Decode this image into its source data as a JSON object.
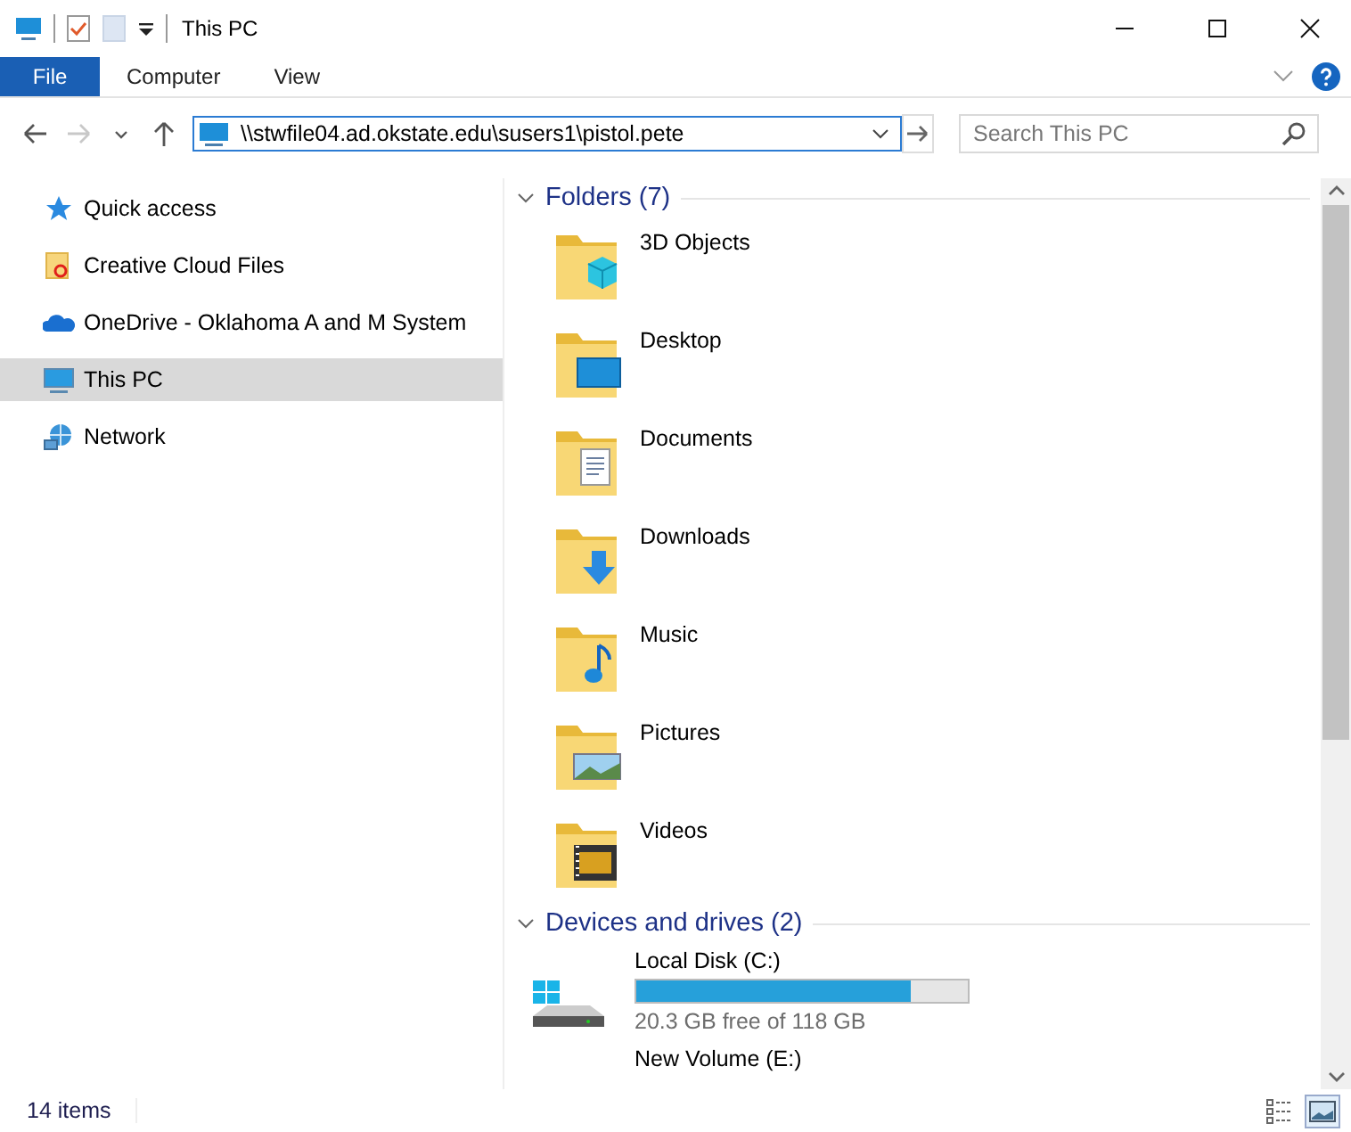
{
  "window": {
    "title": "This PC"
  },
  "ribbon": {
    "tabs": [
      {
        "label": "File",
        "kind": "file"
      },
      {
        "label": "Computer",
        "kind": "tab"
      },
      {
        "label": "View",
        "kind": "tab"
      }
    ]
  },
  "navigation": [
    {
      "kind": "back",
      "disabled": false
    },
    {
      "kind": "forward",
      "disabled": true
    },
    {
      "kind": "recent",
      "disabled": false
    },
    {
      "kind": "up",
      "disabled": false
    }
  ],
  "address_bar": {
    "path": "\\\\stwfile04.ad.okstate.edu\\susers1\\pistol.pete"
  },
  "search": {
    "placeholder": "Search This PC"
  },
  "sidebar": {
    "items": [
      {
        "label": "Quick access",
        "kind": "star",
        "selected": false
      },
      {
        "label": "Creative Cloud Files",
        "kind": "cloudfolder",
        "selected": false
      },
      {
        "label": "OneDrive - Oklahoma A and M System",
        "kind": "onedrive",
        "selected": false
      },
      {
        "label": "This PC",
        "kind": "pc",
        "selected": true
      },
      {
        "label": "Network",
        "kind": "network",
        "selected": false
      }
    ]
  },
  "sections": [
    {
      "title": "Folders (7)",
      "expanded": true,
      "kind": "folders",
      "items": [
        {
          "label": "3D Objects",
          "kind": "cube"
        },
        {
          "label": "Desktop",
          "kind": "desktop"
        },
        {
          "label": "Documents",
          "kind": "documents"
        },
        {
          "label": "Downloads",
          "kind": "downloads"
        },
        {
          "label": "Music",
          "kind": "music"
        },
        {
          "label": "Pictures",
          "kind": "pictures"
        },
        {
          "label": "Videos",
          "kind": "videos"
        }
      ]
    },
    {
      "title": "Devices and drives (2)",
      "expanded": true,
      "kind": "drives",
      "items": [
        {
          "label": "Local Disk (C:)",
          "kind": "system",
          "level": 0.83,
          "reading": "20.3 GB free of 118 GB"
        },
        {
          "label": "New Volume (E:)",
          "kind": "volume"
        }
      ]
    }
  ],
  "status_bar": {
    "text": "14 items",
    "views": [
      {
        "kind": "details",
        "selected": false
      },
      {
        "kind": "large",
        "selected": true
      }
    ]
  }
}
